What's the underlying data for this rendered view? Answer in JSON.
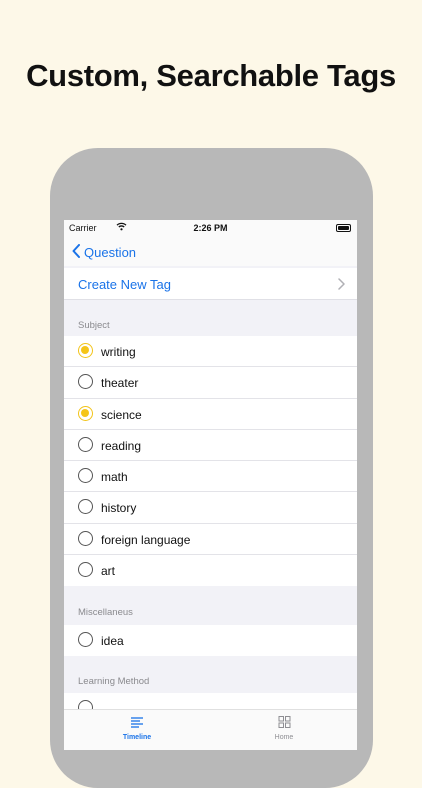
{
  "headline": "Custom, Searchable Tags",
  "status": {
    "carrier": "Carrier",
    "time": "2:26 PM"
  },
  "nav": {
    "back_label": "Question"
  },
  "create_row": {
    "label": "Create New Tag"
  },
  "sections": [
    {
      "header": "Subject",
      "items": [
        {
          "label": "writing",
          "selected": true
        },
        {
          "label": "theater",
          "selected": false
        },
        {
          "label": "science",
          "selected": true
        },
        {
          "label": "reading",
          "selected": false
        },
        {
          "label": "math",
          "selected": false
        },
        {
          "label": "history",
          "selected": false
        },
        {
          "label": "foreign language",
          "selected": false
        },
        {
          "label": "art",
          "selected": false
        }
      ]
    },
    {
      "header": "Miscellaneus",
      "items": [
        {
          "label": "idea",
          "selected": false
        }
      ]
    },
    {
      "header": "Learning Method",
      "items": []
    }
  ],
  "tabbar": {
    "timeline_label": "Timeline",
    "home_label": "Home",
    "active": "Timeline"
  },
  "colors": {
    "accent": "#1a73e8",
    "selected": "#f5c518",
    "background": "#fdf8e8",
    "device": "#b8b8b8"
  },
  "icons": {
    "back": "chevron-left-icon",
    "create": "chevron-right-icon",
    "timeline": "list-icon",
    "home": "grid-icon"
  }
}
